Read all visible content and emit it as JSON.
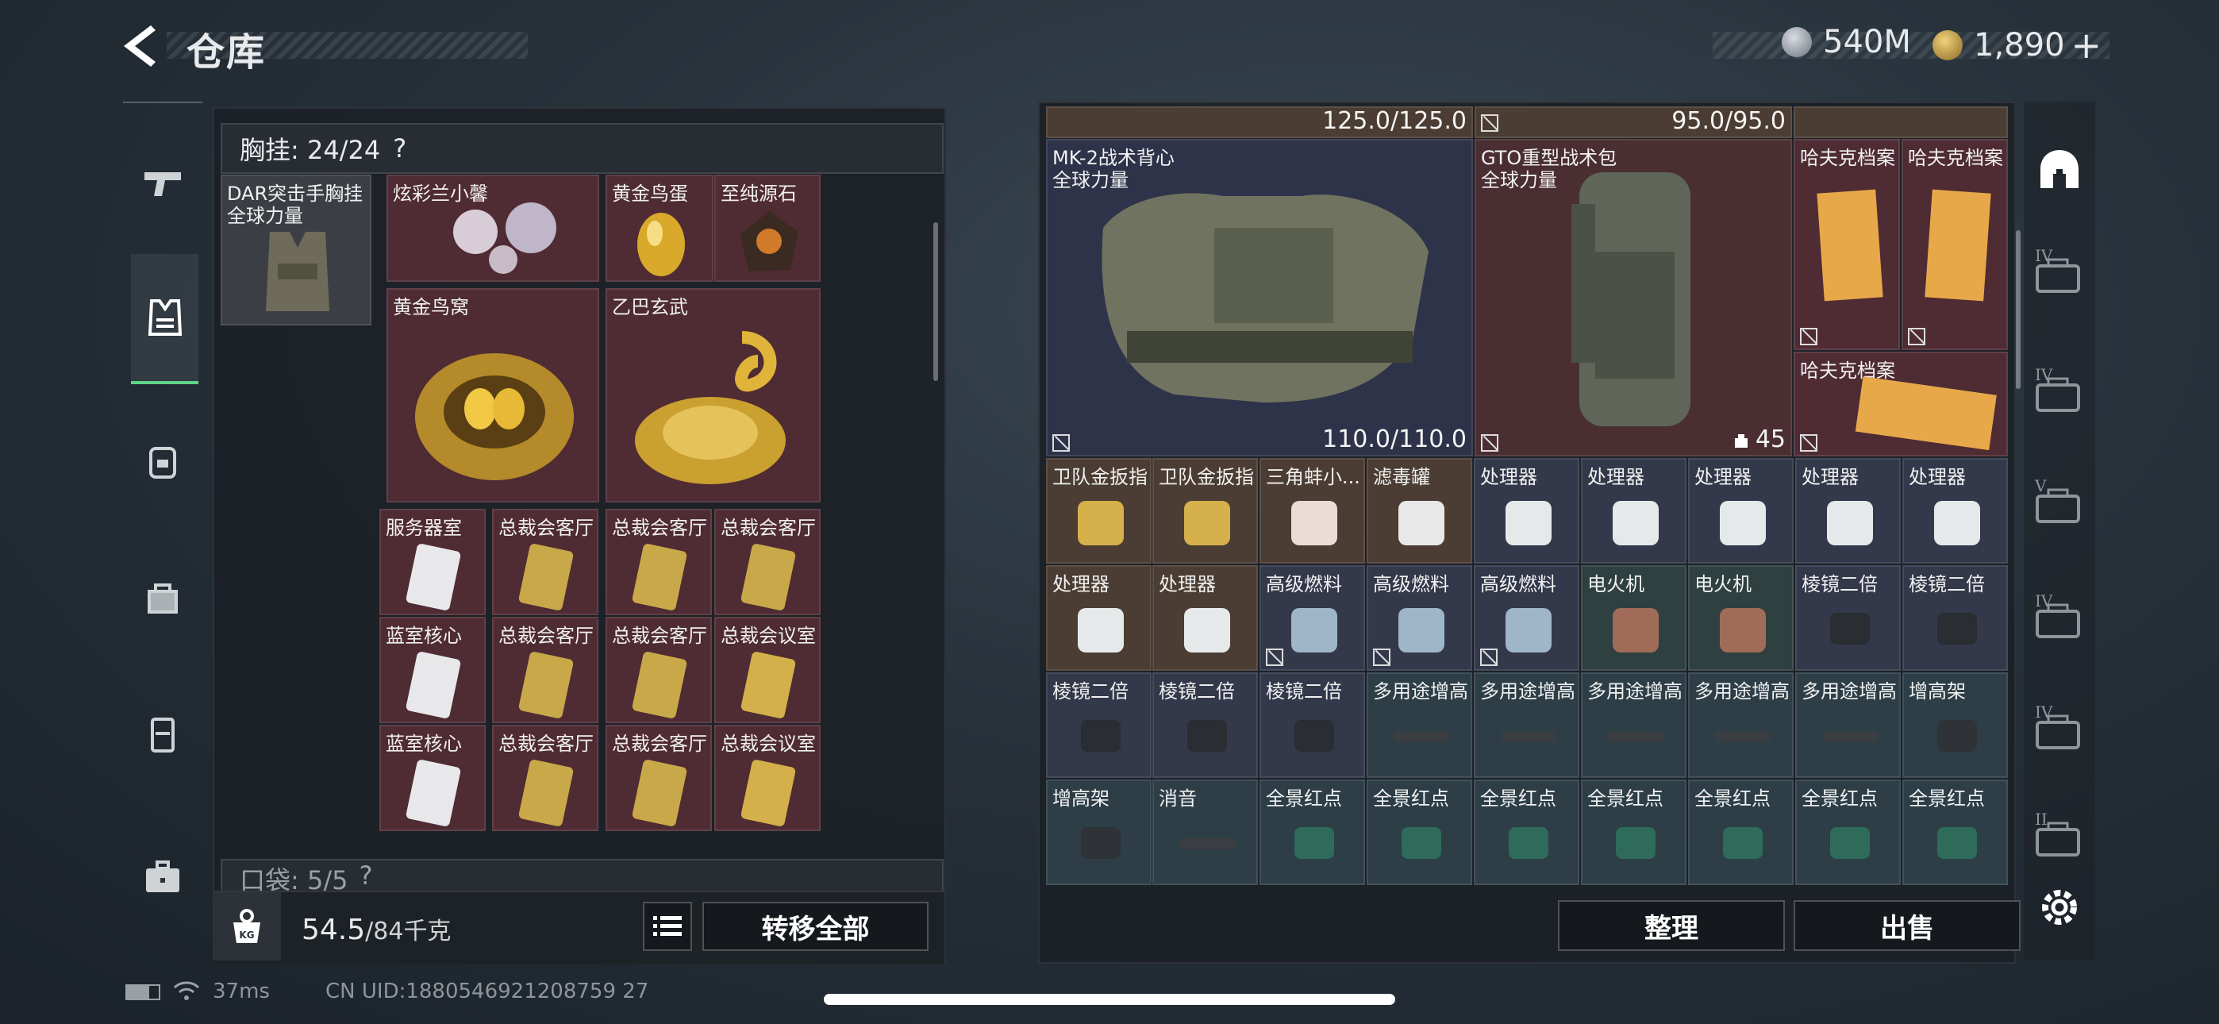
{
  "header": {
    "title": "仓库",
    "currency1": "540M",
    "currency2": "1,890",
    "currency2_plus": "+"
  },
  "left_sidebar": [
    "pistol-icon",
    "vest-icon",
    "backpack-icon",
    "bag-icon",
    "case-icon",
    "briefcase-icon"
  ],
  "chest_rig": {
    "header": "胸挂: 24/24",
    "help": "?",
    "equipped": {
      "name": "DAR突击手胸挂",
      "sub": "全球力量"
    },
    "items": [
      {
        "name": "炫彩兰小馨"
      },
      {
        "name": "黄金鸟蛋"
      },
      {
        "name": "至纯源石"
      },
      {
        "name": "黄金鸟窝"
      },
      {
        "name": "乙巴玄武"
      },
      {
        "name": "服务器室"
      },
      {
        "name": "总裁会客厅"
      },
      {
        "name": "总裁会客厅"
      },
      {
        "name": "总裁会客厅"
      },
      {
        "name": "蓝室核心"
      },
      {
        "name": "总裁会客厅"
      },
      {
        "name": "总裁会客厅"
      },
      {
        "name": "总裁会议室"
      },
      {
        "name": "蓝室核心"
      },
      {
        "name": "总裁会客厅"
      },
      {
        "name": "总裁会客厅"
      },
      {
        "name": "总裁会议室"
      }
    ]
  },
  "pockets": {
    "header": "口袋: 5/5",
    "help": "?"
  },
  "weight": {
    "current": "54.5",
    "max": "/84千克",
    "icon_text": "KG"
  },
  "left_buttons": {
    "transfer_all": "转移全部"
  },
  "storage": {
    "top_dur1": "125.0/125.0",
    "top_dur2": "95.0/95.0",
    "vest": {
      "name": "MK-2战术背心",
      "sub": "全球力量",
      "durability": "110.0/110.0"
    },
    "backpack": {
      "name": "GTO重型战术包",
      "sub": "全球力量",
      "count": "45"
    },
    "files": [
      "哈夫克档案",
      "哈夫克档案",
      "哈夫克档案"
    ],
    "row1": [
      "卫队金扳指",
      "卫队金扳指",
      "三角蚌小...",
      "滤毒罐",
      "处理器",
      "处理器",
      "处理器",
      "处理器",
      "处理器"
    ],
    "row2": [
      "处理器",
      "处理器",
      "高级燃料",
      "高级燃料",
      "高级燃料",
      "电火机",
      "电火机",
      "棱镜二倍",
      "棱镜二倍"
    ],
    "row3": [
      "棱镜二倍",
      "棱镜二倍",
      "棱镜二倍",
      "多用途增高",
      "多用途增高",
      "多用途增高",
      "多用途增高",
      "多用途增高",
      "增高架"
    ],
    "row4": [
      "增高架",
      "消音",
      "全景红点",
      "全景红点",
      "全景红点",
      "全景红点",
      "全景红点",
      "全景红点",
      "全景红点"
    ]
  },
  "right_buttons": {
    "organize": "整理",
    "sell": "出售"
  },
  "right_sidebar": [
    {
      "icon": "home-base-icon",
      "label": ""
    },
    {
      "icon": "case-tab-icon",
      "label": "IV"
    },
    {
      "icon": "case-tab-icon",
      "label": "IV"
    },
    {
      "icon": "case-tab-icon",
      "label": "V"
    },
    {
      "icon": "case-tab-icon",
      "label": "IV"
    },
    {
      "icon": "case-tab-icon",
      "label": "IV"
    },
    {
      "icon": "case-tab-icon",
      "label": "II"
    }
  ],
  "status_bar": {
    "ping": "37ms",
    "uid": "CN UID:1880546921208759 27"
  },
  "colors": {
    "accent_green": "#5fd38a",
    "cell_red": "#4f2b33",
    "cell_teal": "#2d3e47"
  }
}
